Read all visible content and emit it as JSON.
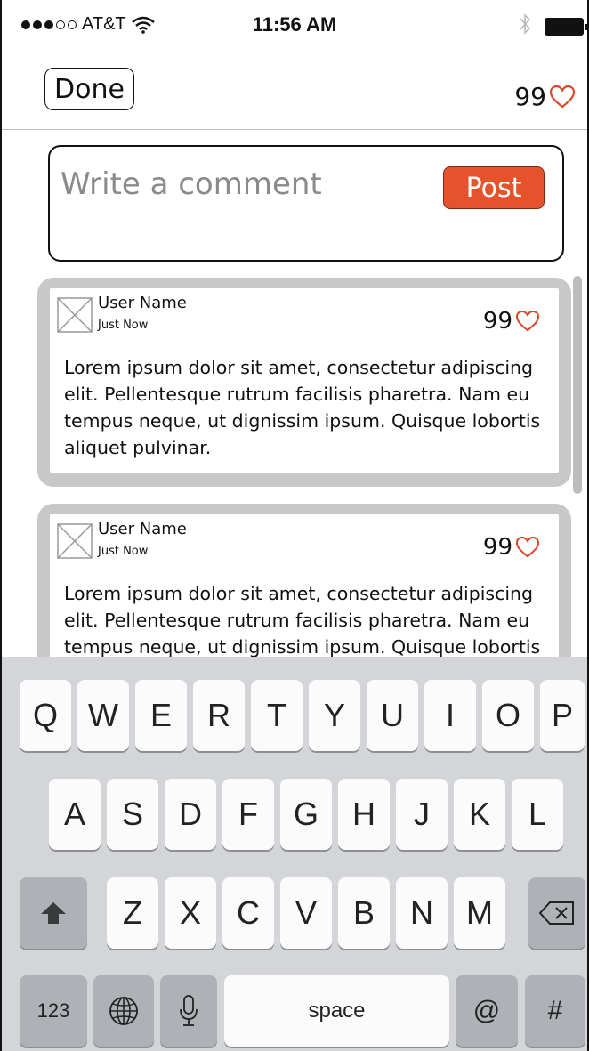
{
  "status_bar": {
    "carrier": "AT&T",
    "time": "11:56 AM",
    "signal_bars_filled": 3,
    "signal_bars_total": 5
  },
  "header": {
    "done_label": "Done",
    "likes": "99"
  },
  "composer": {
    "placeholder": "Write a comment",
    "post_label": "Post"
  },
  "comments": [
    {
      "user": "User Name",
      "time": "Just Now",
      "likes": "99",
      "body": "Lorem ipsum dolor sit amet, consectetur adipiscing elit. Pellentesque rutrum facilisis pharetra. Nam eu tempus neque, ut dignissim ipsum. Quisque lobortis aliquet pulvinar."
    },
    {
      "user": "User Name",
      "time": "Just Now",
      "likes": "99",
      "body": "Lorem ipsum dolor sit amet, consectetur adipiscing elit. Pellentesque rutrum facilisis pharetra. Nam eu tempus neque, ut dignissim ipsum. Quisque lobortis aliquet pulvinar."
    }
  ],
  "keyboard": {
    "row1": [
      "Q",
      "W",
      "E",
      "R",
      "T",
      "Y",
      "U",
      "I",
      "O",
      "P"
    ],
    "row2": [
      "A",
      "S",
      "D",
      "F",
      "G",
      "H",
      "J",
      "K",
      "L"
    ],
    "row3": [
      "Z",
      "X",
      "C",
      "V",
      "B",
      "N",
      "M"
    ],
    "numbers_label": "123",
    "space_label": "space",
    "at_label": "@",
    "hash_label": "#"
  },
  "colors": {
    "accent": "#e4532c",
    "heart": "#d94a2b"
  }
}
